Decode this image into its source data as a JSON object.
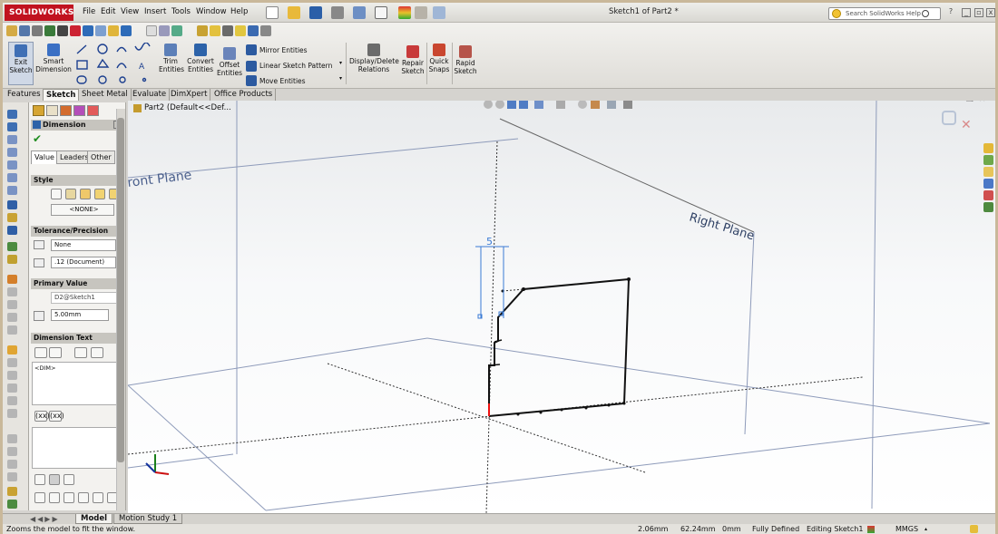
{
  "app": {
    "logo_text": "SOLIDWORKS",
    "menu": [
      "File",
      "Edit",
      "View",
      "Insert",
      "Tools",
      "Window",
      "Help"
    ],
    "document_title": "Sketch1 of Part2 *",
    "search_placeholder": "Search SolidWorks Help"
  },
  "commands": {
    "exit_sketch": "Exit\nSketch",
    "smart_dimension": "Smart\nDimension",
    "trim_entities": "Trim\nEntities",
    "convert_entities": "Convert\nEntities",
    "offset_entities": "Offset\nEntities",
    "mirror_entities": "Mirror Entities",
    "linear_sketch_pattern": "Linear Sketch Pattern",
    "move_entities": "Move Entities",
    "display_delete_relations": "Display/Delete\nRelations",
    "repair_sketch": "Repair\nSketch",
    "quick_snaps": "Quick\nSnaps",
    "rapid_sketch": "Rapid\nSketch"
  },
  "tabs": [
    "Features",
    "Sketch",
    "Sheet Metal",
    "Evaluate",
    "DimXpert",
    "Office Products"
  ],
  "active_tab": "Sketch",
  "property_manager": {
    "title": "Dimension",
    "help": "?",
    "subtabs": [
      "Value",
      "Leaders",
      "Other"
    ],
    "style_label": "Style",
    "style_value": "<NONE>",
    "tolerance_label": "Tolerance/Precision",
    "tolerance_value": "None",
    "precision_value": ".12 (Document)",
    "primary_value_label": "Primary Value",
    "primary_name": "D2@Sketch1",
    "primary_value": "5.00mm",
    "dimension_text_label": "Dimension Text",
    "dimension_text_value": "<DIM>",
    "paren_buttons": [
      "(xx)",
      "(xx)"
    ]
  },
  "tree": {
    "part_label": "Part2  (Default<<Def..."
  },
  "viewport": {
    "front_plane_label": "ront Plane",
    "right_plane_label": "Right Plane",
    "dimension_value": "5"
  },
  "bottom_tabs": [
    "Model",
    "Motion Study 1"
  ],
  "active_bottom_tab": "Model",
  "status": {
    "message": "Zooms the model to fit the window.",
    "x": "2.06mm",
    "y": "62.24mm",
    "z": "0mm",
    "definition": "Fully Defined",
    "editing": "Editing Sketch1",
    "units": "MMGS"
  }
}
